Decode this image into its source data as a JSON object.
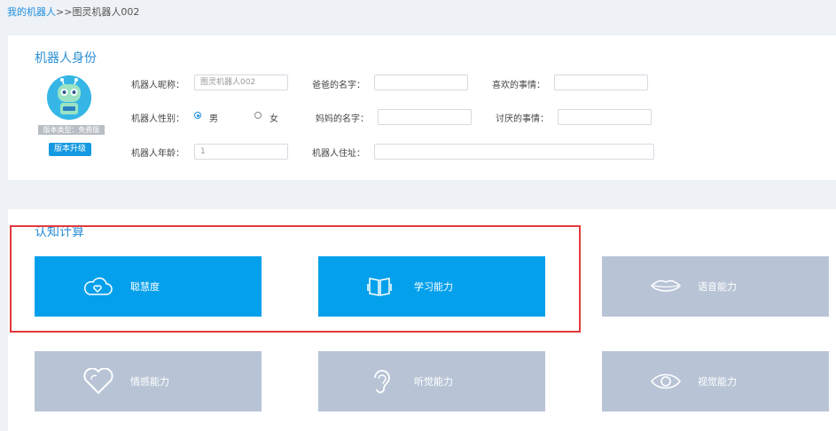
{
  "breadcrumb": {
    "link": "我的机器人",
    "separator": ">>",
    "current": "图灵机器人002"
  },
  "identity": {
    "title": "机器人身份",
    "version_type": "版本类型：免费版",
    "upgrade_label": "版本升级",
    "nickname_label": "机器人昵称：",
    "nickname_value": "图灵机器人002",
    "father_label": "爸爸的名字：",
    "likes_label": "喜欢的事情：",
    "gender_label": "机器人性别：",
    "gender_male": "男",
    "gender_female": "女",
    "mother_label": "妈妈的名字：",
    "dislikes_label": "讨厌的事情：",
    "age_label": "机器人年龄：",
    "age_value": "1",
    "address_label": "机器人住址："
  },
  "cognition": {
    "title": "认知计算",
    "tiles": [
      {
        "label": "聪慧度",
        "icon": "cloud-heart-icon",
        "state": "active"
      },
      {
        "label": "学习能力",
        "icon": "book-icon",
        "state": "active"
      },
      {
        "label": "语音能力",
        "icon": "lips-icon",
        "state": "inactive"
      },
      {
        "label": "情感能力",
        "icon": "heart-icon",
        "state": "inactive"
      },
      {
        "label": "听觉能力",
        "icon": "ear-icon",
        "state": "inactive"
      },
      {
        "label": "视觉能力",
        "icon": "eye-icon",
        "state": "inactive"
      }
    ]
  },
  "colors": {
    "accent": "#05a0ec",
    "inactive_tile": "#b8c4d6",
    "highlight": "#e4393c"
  }
}
